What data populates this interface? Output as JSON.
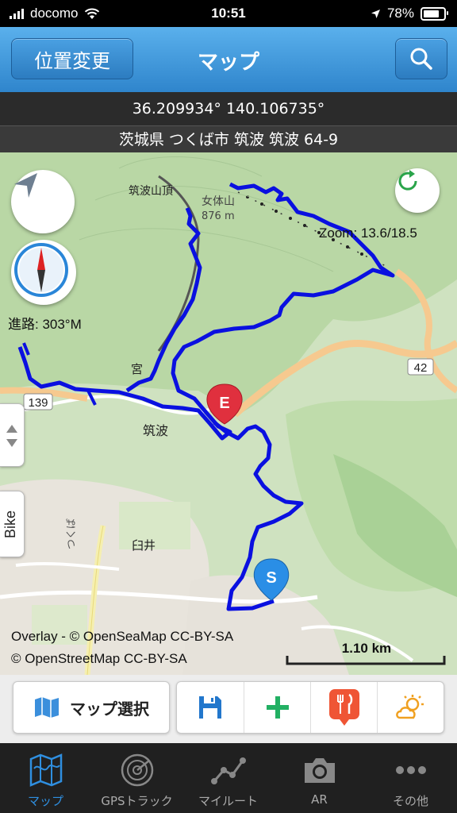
{
  "status_bar": {
    "carrier": "docomo",
    "time": "10:51",
    "battery": "78%"
  },
  "nav": {
    "left_button": "位置変更",
    "title": "マップ",
    "search_icon": "search-icon"
  },
  "location": {
    "coords": "36.209934° 140.106735°",
    "address": "茨城県 つくば市 筑波 筑波 64-9"
  },
  "map": {
    "zoom": "Zoom: 13.6/18.5",
    "heading": "進路: 303°M",
    "side_label": "Bike",
    "labels": {
      "summit_a": "筑波山頂",
      "summit_b": "女体山",
      "summit_b_elev": "876 m",
      "place_tsukuba": "筑波",
      "place_miya": "宮",
      "place_usui": "臼井",
      "route_a": "42",
      "route_b": "139",
      "road_tsukuba": "つくば"
    },
    "markers": {
      "end": "E",
      "start": "S"
    },
    "attribution_1": "Overlay - © OpenSeaMap CC-BY-SA",
    "attribution_2": "© OpenStreetMap CC-BY-SA",
    "scale": "1.10 km",
    "track_color": "#0a10e0"
  },
  "toolbar": {
    "map_select": "マップ選択"
  },
  "tabs": [
    {
      "label": "マップ",
      "icon": "map-icon",
      "active": true
    },
    {
      "label": "GPSトラック",
      "icon": "radar-icon",
      "active": false
    },
    {
      "label": "マイルート",
      "icon": "route-icon",
      "active": false
    },
    {
      "label": "AR",
      "icon": "camera-icon",
      "active": false
    },
    {
      "label": "その他",
      "icon": "more-icon",
      "active": false
    }
  ],
  "colors": {
    "accent": "#2f85cc",
    "active_tab": "#2f8fe0"
  }
}
